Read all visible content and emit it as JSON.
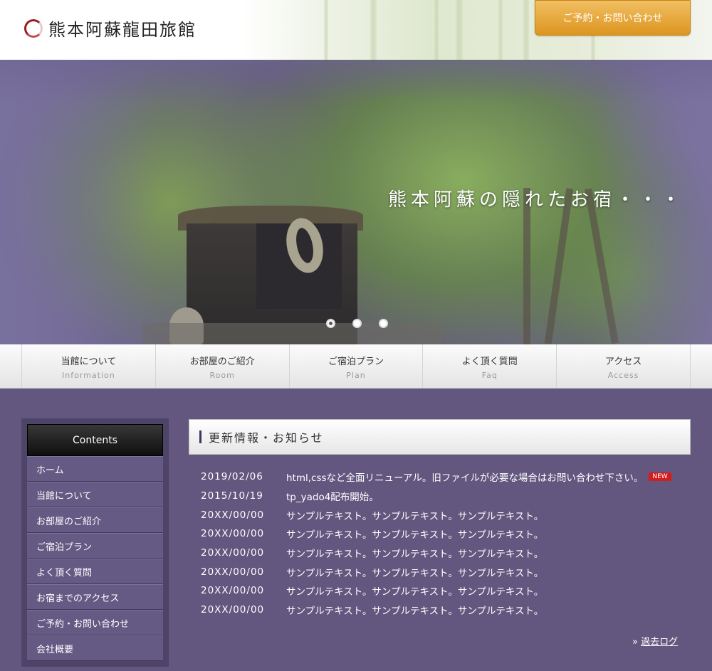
{
  "header": {
    "logo_text": "熊本阿蘇龍田旅館",
    "reserve_label": "ご予約・お問い合わせ"
  },
  "hero": {
    "caption": "熊本阿蘇の隠れたお宿・・・",
    "slide_count": 3,
    "active_slide": 1
  },
  "nav": {
    "items": [
      {
        "ja": "当館について",
        "en": "Information"
      },
      {
        "ja": "お部屋のご紹介",
        "en": "Room"
      },
      {
        "ja": "ご宿泊プラン",
        "en": "Plan"
      },
      {
        "ja": "よく頂く質問",
        "en": "Faq"
      },
      {
        "ja": "アクセス",
        "en": "Access"
      }
    ]
  },
  "sidebar": {
    "title": "Contents",
    "items": [
      {
        "label": "ホーム"
      },
      {
        "label": "当館について"
      },
      {
        "label": "お部屋のご紹介"
      },
      {
        "label": "ご宿泊プラン"
      },
      {
        "label": "よく頂く質問"
      },
      {
        "label": "お宿までのアクセス"
      },
      {
        "label": "ご予約・お問い合わせ"
      },
      {
        "label": "会社概要"
      }
    ]
  },
  "news": {
    "title": "更新情報・お知らせ",
    "new_badge": "NEW",
    "items": [
      {
        "date": "2019/02/06",
        "text": "html,cssなど全面リニューアル。旧ファイルが必要な場合はお問い合わせ下さい。"
      },
      {
        "date": "2015/10/19",
        "text": "tp_yado4配布開始。"
      },
      {
        "date": "20XX/00/00",
        "text": "サンプルテキスト。サンプルテキスト。サンプルテキスト。"
      },
      {
        "date": "20XX/00/00",
        "text": "サンプルテキスト。サンプルテキスト。サンプルテキスト。"
      },
      {
        "date": "20XX/00/00",
        "text": "サンプルテキスト。サンプルテキスト。サンプルテキスト。"
      },
      {
        "date": "20XX/00/00",
        "text": "サンプルテキスト。サンプルテキスト。サンプルテキスト。"
      },
      {
        "date": "20XX/00/00",
        "text": "サンプルテキスト。サンプルテキスト。サンプルテキスト。"
      },
      {
        "date": "20XX/00/00",
        "text": "サンプルテキスト。サンプルテキスト。サンプルテキスト。"
      }
    ],
    "past_log_label": "過去ログ"
  },
  "colors": {
    "background": "#63577f",
    "reserve_button": "#e8a331",
    "brand_red": "#9b1c20",
    "new_badge": "#d51b1b"
  }
}
